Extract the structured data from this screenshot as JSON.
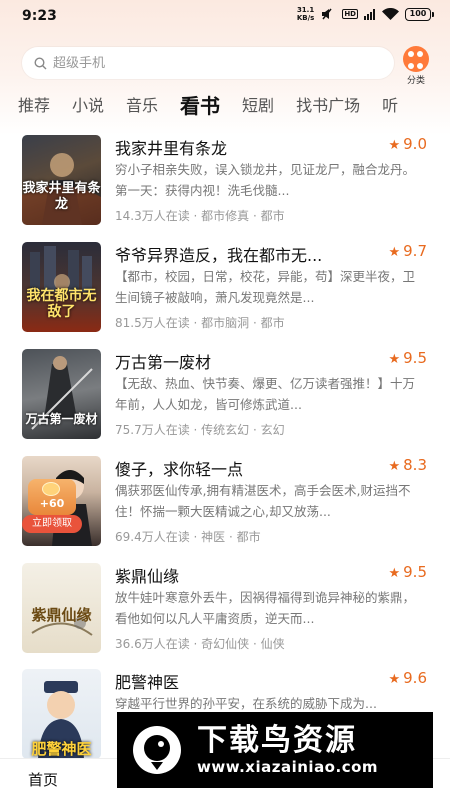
{
  "status_bar": {
    "time": "9:23",
    "net_speed": "31.1",
    "net_unit": "KB/s",
    "hd": "HD",
    "battery": "100"
  },
  "search": {
    "placeholder": "超级手机"
  },
  "category_button": {
    "label": "分类",
    "icon": "category-dots-icon",
    "color": "#ff7a3a"
  },
  "tabs": [
    "推荐",
    "小说",
    "音乐",
    "看书",
    "短剧",
    "找书广场",
    "听"
  ],
  "active_tab": "看书",
  "accent_color": "#e86a1f",
  "books": [
    {
      "title": "我家井里有条龙",
      "rating": "9.0",
      "description": "穷小子相亲失败，误入锁龙井，见证龙尸，融合龙丹。　　第一天：获得内视！洗毛伐髓...",
      "meta": "14.3万人在读 · 都市修真 · 都市",
      "cover_text": "我家井里有条龙"
    },
    {
      "title": "爷爷异界造反，我在都市无...",
      "rating": "9.7",
      "description": "【都市，校园，日常，校花，异能，苟】深更半夜，卫生间镜子被敲响，萧凡发现竟然是...",
      "meta": "81.5万人在读 · 都市脑洞 · 都市",
      "cover_text": "我在都市无敌了"
    },
    {
      "title": "万古第一废材",
      "rating": "9.5",
      "description": "【无敌、热血、快节奏、爆更、亿万读者强推！】十万年前，人人如龙，皆可修炼武道...",
      "meta": "75.7万人在读 · 传统玄幻 · 玄幻",
      "cover_text": "万古第一废材"
    },
    {
      "title": "傻子，求你轻一点",
      "rating": "8.3",
      "description": "偶获邪医仙传承,拥有精湛医术，高手会医术,财运挡不住！怀揣一颗大医精诚之心,却又放荡...",
      "meta": "69.4万人在读 · 神医 · 都市",
      "cover_text": ""
    },
    {
      "title": "紫鼎仙缘",
      "rating": "9.5",
      "description": "放牛娃叶寒意外丢牛，因祸得福得到诡异神秘的紫鼎，看他如何以凡人平庸资质，逆天而...",
      "meta": "36.6万人在读 · 奇幻仙侠 · 仙侠",
      "cover_text": "紫鼎仙缘"
    },
    {
      "title": "肥警神医",
      "rating": "9.6",
      "description": "穿越平行世界的孙平安，在系统的威胁下成为...",
      "meta": "",
      "cover_text": "肥警神医"
    }
  ],
  "promo": {
    "amount": "+60",
    "claim_label": "立即领取"
  },
  "bottom_nav": {
    "home": "首页"
  },
  "watermark": {
    "text": "下载鸟资源",
    "url": "www.xiazainiao.com"
  }
}
